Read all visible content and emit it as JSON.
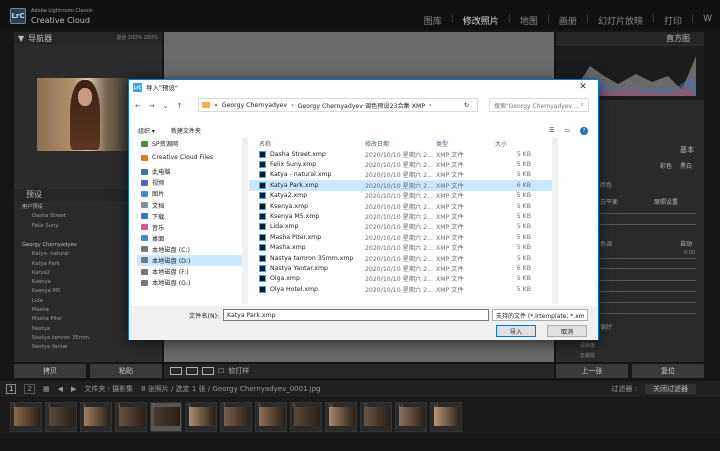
{
  "app": {
    "brand_small": "Adobe Lightroom Classic",
    "brand": "Creative Cloud",
    "logo": "LrC"
  },
  "modules": [
    "图库",
    "修改照片",
    "地图",
    "画册",
    "幻灯片放映",
    "打印",
    "W"
  ],
  "left_panel": {
    "navigator_title": "导航器",
    "nav_controls": "适合  100%  200%",
    "presets_title": "预设",
    "user_presets_group": "用户预设",
    "user_presets": [
      "Dasha Street",
      "Felix Suny"
    ],
    "group_name": "Georgy Chernyadyev",
    "group_presets": [
      "Katya- natural",
      "Katya Park",
      "Katya2",
      "Ksenya",
      "Ksenya M5",
      "Lida",
      "Masha",
      "Masha Piter",
      "Nastya",
      "Nastya tamron 35mm",
      "Nastya Yantar"
    ],
    "copy_button": "拷贝",
    "paste_button": "粘贴"
  },
  "toolbar": {
    "soft_proof": "软打样"
  },
  "right_panel": {
    "histogram_title": "直方图",
    "basic_title": "基本",
    "color_label": "彩色",
    "bw_label": "黑白",
    "profile_label": "颜色",
    "wb_label": "白平衡",
    "wb_value": "原照设置",
    "tone_label": "色调",
    "auto_label": "自动",
    "exposure_value": "0.00",
    "presence_label": "偏好",
    "clarity_label": "清晰度",
    "dehaze_label": "去朦胧",
    "prev_button": "上一张",
    "reset_button": "复位"
  },
  "filmstrip_bar": {
    "pages": [
      "1",
      "2"
    ],
    "source": "文件夹 : 摄影集",
    "info": "8 张照片 / 选定 1 张 / Georgy Chernyadyev_0001.jpg",
    "filter_label": "过滤器 :",
    "filter_value": "关闭过滤器",
    "thumb_numbers": [
      "1",
      "2",
      "3",
      "4",
      "5",
      "6",
      "7",
      "8",
      "9",
      "10",
      "11",
      "12",
      "13"
    ]
  },
  "dialog": {
    "title": "导入\"预设\"",
    "close": "✕",
    "path": [
      "Georgy Chernyadyev",
      "Georgy Chernyadyev  调色预设23合集 XMP"
    ],
    "search_placeholder": "搜索\"Georgy Chernyadyev ...",
    "organize": "组织 ▾",
    "new_folder": "新建文件夹",
    "nav_items": [
      {
        "label": "SP资源网",
        "color": "#4a8f3a"
      },
      {
        "label": "Creative Cloud Files",
        "color": "#e87722"
      },
      {
        "label": "此电脑",
        "color": "#3c6fb5"
      },
      {
        "label": "视频",
        "color": "#5b5bd6"
      },
      {
        "label": "图片",
        "color": "#3c8fd6"
      },
      {
        "label": "文档",
        "color": "#7a8ea6"
      },
      {
        "label": "下载",
        "color": "#2d7ad6"
      },
      {
        "label": "音乐",
        "color": "#d65b8a"
      },
      {
        "label": "桌面",
        "color": "#3c8fd6"
      },
      {
        "label": "本地磁盘 (C:)",
        "color": "#777"
      },
      {
        "label": "本地磁盘 (D:)",
        "color": "#777",
        "selected": true
      },
      {
        "label": "本地磁盘 (F:)",
        "color": "#777"
      },
      {
        "label": "本地磁盘 (G:)",
        "color": "#777"
      }
    ],
    "columns": {
      "name": "名称",
      "date": "修改日期",
      "type": "类型",
      "size": "大小"
    },
    "files": [
      {
        "name": "Dasha Street.xmp",
        "date": "2020/10/10 星期六 2...",
        "type": "XMP 文件",
        "size": "5 KB"
      },
      {
        "name": "Felix Suny.xmp",
        "date": "2020/10/10 星期六 2...",
        "type": "XMP 文件",
        "size": "5 KB"
      },
      {
        "name": "Katya - natural.xmp",
        "date": "2020/10/10 星期六 2...",
        "type": "XMP 文件",
        "size": "5 KB"
      },
      {
        "name": "Katya Park.xmp",
        "date": "2020/10/10 星期六 2...",
        "type": "XMP 文件",
        "size": "6 KB",
        "selected": true
      },
      {
        "name": "Katya2.xmp",
        "date": "2020/10/10 星期六 2...",
        "type": "XMP 文件",
        "size": "5 KB"
      },
      {
        "name": "Ksenya.xmp",
        "date": "2020/10/10 星期六 2...",
        "type": "XMP 文件",
        "size": "5 KB"
      },
      {
        "name": "Ksenya M5.xmp",
        "date": "2020/10/10 星期六 2...",
        "type": "XMP 文件",
        "size": "5 KB"
      },
      {
        "name": "Lida.xmp",
        "date": "2020/10/10 星期六 2...",
        "type": "XMP 文件",
        "size": "5 KB"
      },
      {
        "name": "Masha Piter.xmp",
        "date": "2020/10/10 星期六 2...",
        "type": "XMP 文件",
        "size": "5 KB"
      },
      {
        "name": "Masha.xmp",
        "date": "2020/10/10 星期六 2...",
        "type": "XMP 文件",
        "size": "5 KB"
      },
      {
        "name": "Nastya tamron 35mm.xmp",
        "date": "2020/10/10 星期六 2...",
        "type": "XMP 文件",
        "size": "5 KB"
      },
      {
        "name": "Nastya Yantar.xmp",
        "date": "2020/10/10 星期六 2...",
        "type": "XMP 文件",
        "size": "6 KB"
      },
      {
        "name": "Olga.xmp",
        "date": "2020/10/10 星期六 2...",
        "type": "XMP 文件",
        "size": "5 KB"
      },
      {
        "name": "Olya Hotel.xmp",
        "date": "2020/10/10 星期六 2...",
        "type": "XMP 文件",
        "size": "5 KB"
      }
    ],
    "filename_label": "文件名(N):",
    "filename_value": "Katya Park.xmp",
    "filetype_value": "支持的文件 (*.lrtemplate; *.xm",
    "ok_button": "导入",
    "cancel_button": "取消"
  }
}
